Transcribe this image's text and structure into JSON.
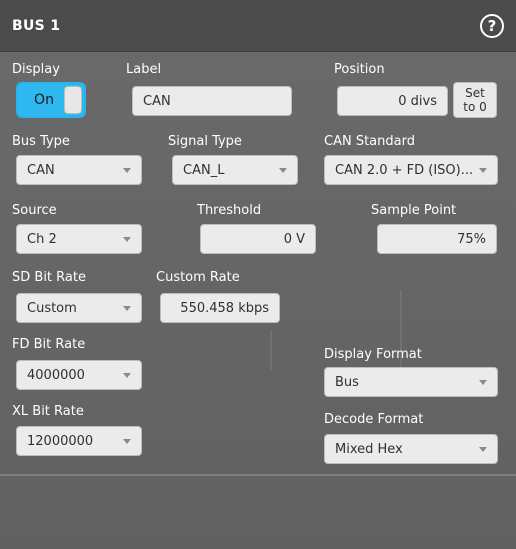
{
  "title": "BUS 1",
  "help_icon": "question-circle-icon",
  "display": {
    "label": "Display",
    "toggle_value": "On"
  },
  "label_field": {
    "label": "Label",
    "value": "CAN"
  },
  "position": {
    "label": "Position",
    "value": "0 divs",
    "set_button": [
      "Set",
      "to 0"
    ]
  },
  "bus_type": {
    "label": "Bus Type",
    "value": "CAN"
  },
  "signal_type": {
    "label": "Signal Type",
    "value": "CAN_L"
  },
  "can_standard": {
    "label": "CAN Standard",
    "value": "CAN 2.0 + FD (ISO)..."
  },
  "source": {
    "label": "Source",
    "value": "Ch 2"
  },
  "threshold": {
    "label": "Threshold",
    "value": "0 V"
  },
  "sample_point": {
    "label": "Sample Point",
    "value": "75%"
  },
  "sd_bit_rate": {
    "label": "SD Bit Rate",
    "value": "Custom"
  },
  "custom_rate": {
    "label": "Custom Rate",
    "value": "550.458 kbps"
  },
  "fd_bit_rate": {
    "label": "FD Bit Rate",
    "value": "4000000"
  },
  "display_format": {
    "label": "Display Format",
    "value": "Bus"
  },
  "xl_bit_rate": {
    "label": "XL Bit Rate",
    "value": "12000000"
  },
  "decode_format": {
    "label": "Decode Format",
    "value": "Mixed Hex"
  }
}
